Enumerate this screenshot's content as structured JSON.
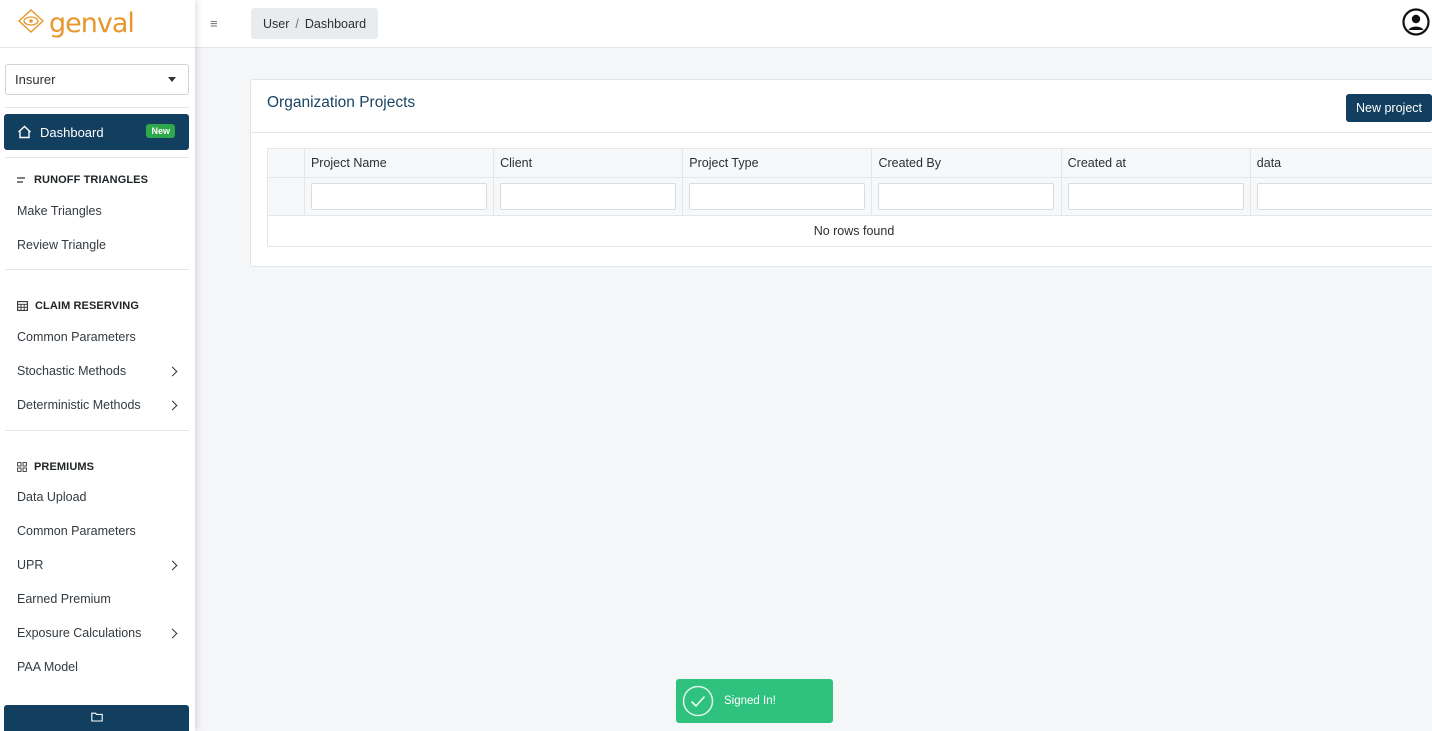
{
  "brand": {
    "logo_text": "genval",
    "accent": "#e8962e",
    "primary": "#123f5f",
    "success": "#2ec27e"
  },
  "sidebar": {
    "org_select": {
      "value": "Insurer"
    },
    "dashboard": {
      "label": "Dashboard",
      "badge": "New",
      "icon": "home-icon"
    },
    "sections": [
      {
        "title": "RUNOFF TRIANGLES",
        "icon": "filter-lines-icon",
        "items": [
          {
            "label": "Make Triangles",
            "has_submenu": false
          },
          {
            "label": "Review Triangle",
            "has_submenu": false
          }
        ]
      },
      {
        "title": "CLAIM RESERVING",
        "icon": "table-icon",
        "items": [
          {
            "label": "Common Parameters",
            "has_submenu": false
          },
          {
            "label": "Stochastic Methods",
            "has_submenu": true
          },
          {
            "label": "Deterministic Methods",
            "has_submenu": true
          }
        ]
      },
      {
        "title": "PREMIUMS",
        "icon": "grid-icon",
        "items": [
          {
            "label": "Data Upload",
            "has_submenu": false
          },
          {
            "label": "Common Parameters",
            "has_submenu": false
          },
          {
            "label": "UPR",
            "has_submenu": true
          },
          {
            "label": "Earned Premium",
            "has_submenu": false
          },
          {
            "label": "Exposure Calculations",
            "has_submenu": true
          },
          {
            "label": "PAA Model",
            "has_submenu": false
          }
        ]
      }
    ],
    "bottom_button_icon": "folder-icon"
  },
  "topbar": {
    "menu_icon": "≡",
    "breadcrumb": [
      "User",
      "Dashboard"
    ],
    "breadcrumb_separator": "/"
  },
  "card": {
    "title": "Organization Projects",
    "new_project_label": "New project",
    "columns": [
      "Project Name",
      "Client",
      "Project Type",
      "Created By",
      "Created at",
      "data"
    ],
    "empty_text": "No rows found"
  },
  "toast": {
    "text": "Signed In!"
  }
}
